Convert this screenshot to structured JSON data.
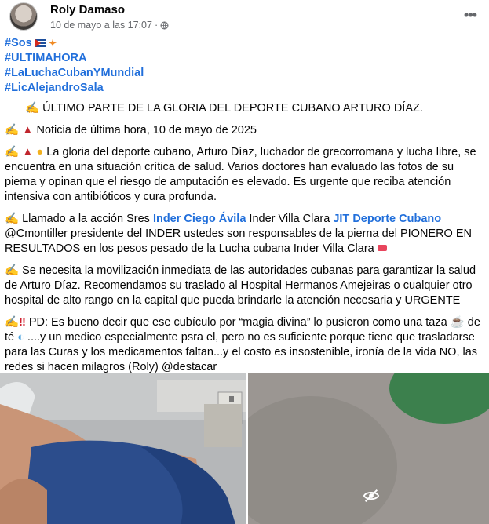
{
  "post": {
    "author": "Roly Damaso",
    "date": "10 de mayo a las 17:07",
    "separator": "·",
    "more_label": "•••",
    "hashtags": [
      "#Sos",
      "#ULTIMAHORA",
      "#LaLuchaCubanYMundial",
      "#LicAlejandroSala"
    ],
    "title": "ÚLTIMO PARTE DE LA GLORIA DEL DEPORTE CUBANO ARTURO DÍAZ.",
    "p1": "Noticia de última hora, 10 de mayo de 2025",
    "p2": "La gloria del deporte cubano, Arturo Díaz, luchador de grecorromana y lucha libre, se encuentra en una situación crítica de salud. Varios doctores han evaluado las fotos de su pierna y opinan que el riesgo de amputación es elevado. Es urgente que reciba atención intensiva con antibióticos y cura profunda.",
    "p3_a": "Llamado a la acción Sres ",
    "p3_link1": "Inder Ciego Ávila",
    "p3_b": " Inder Villa Clara ",
    "p3_link2": "JIT Deporte Cubano",
    "p3_c": " @Cmontiller presidente del INDER ustedes son responsables de la pierna del PIONERO EN RESULTADOS en los pesos pesado de la Lucha cubana Inder Villa Clara",
    "p4": "Se necesita la movilización inmediata de las autoridades cubanas para garantizar la salud de Arturo Díaz. Recomendamos su traslado al Hospital Hermanos Amejeiras o cualquier otro hospital de alto rango en la capital que pueda brindarle la atención necesaria y URGENTE",
    "p5_a": "PD: Es bueno decir que ese cubículo por “magia divina” lo pusieron como una taza",
    "p5_b": " de té",
    "p5_c": " ....y un medico especialmente psra el, pero no es suficiente porque tiene que trasladarse para las Curas y los medicamentos faltan...y el costo es insostenible, ironía de la vida NO, las redes si hacen milagros (Roly) @destacar"
  },
  "icons": {
    "avatar": "profile-photo",
    "globe": "globe-icon",
    "more": "more-options-icon",
    "hidden": "eye-off-icon"
  },
  "colors": {
    "link": "#216fdb",
    "meta": "#65676b",
    "text": "#050505"
  }
}
